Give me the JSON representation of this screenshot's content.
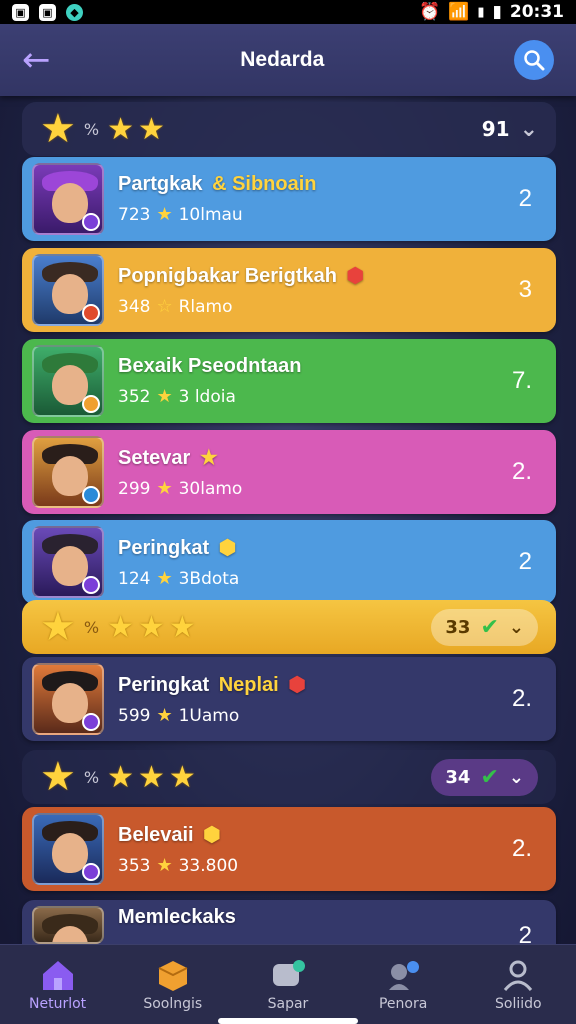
{
  "status_bar": {
    "time": "20:31"
  },
  "app_bar": {
    "title": "Nedarda"
  },
  "star_rows": [
    {
      "sep": "%",
      "value": "91"
    },
    {
      "sep": "%",
      "pill_value": "33"
    },
    {
      "sep": "%",
      "pill_value": "34"
    }
  ],
  "cards": [
    {
      "name": "Partgkak",
      "name_extra": "& Sibnoain",
      "score": "723",
      "label": "10lmau",
      "rank": "2",
      "color": "#4f9be0"
    },
    {
      "name": "Popnigbakar Berigtkah",
      "name_extra": "",
      "score": "348",
      "label": "Rlamo",
      "rank": "3",
      "color": "#f0b13a"
    },
    {
      "name": "Bexaik Pseodntaan",
      "name_extra": "",
      "score": "352",
      "label": "3 ldoia",
      "rank": "7.",
      "color": "#4cb84d"
    },
    {
      "name": "Setevar",
      "name_extra": "",
      "score": "299",
      "label": "30lamo",
      "rank": "2.",
      "color": "#d85bb7"
    },
    {
      "name": "Peringkat",
      "name_extra": "",
      "score": "124",
      "label": "3Bdota",
      "rank": "2",
      "color": "#4f9be0"
    },
    {
      "name": "Peringkat",
      "name_extra": "Neplai",
      "score": "599",
      "label": "1Uamo",
      "rank": "2.",
      "color": "#34386a"
    },
    {
      "name": "Belevaii",
      "name_extra": "",
      "score": "353",
      "label": "33.800",
      "rank": "2.",
      "color": "#c8592c"
    },
    {
      "name": "Memleckaks",
      "name_extra": "",
      "score": "",
      "label": "",
      "rank": "2",
      "color": "#34386a"
    }
  ],
  "bottom_nav": [
    {
      "label": "Neturlot"
    },
    {
      "label": "Soolngis"
    },
    {
      "label": "Sapar"
    },
    {
      "label": "Penora"
    },
    {
      "label": "Soliido"
    }
  ]
}
